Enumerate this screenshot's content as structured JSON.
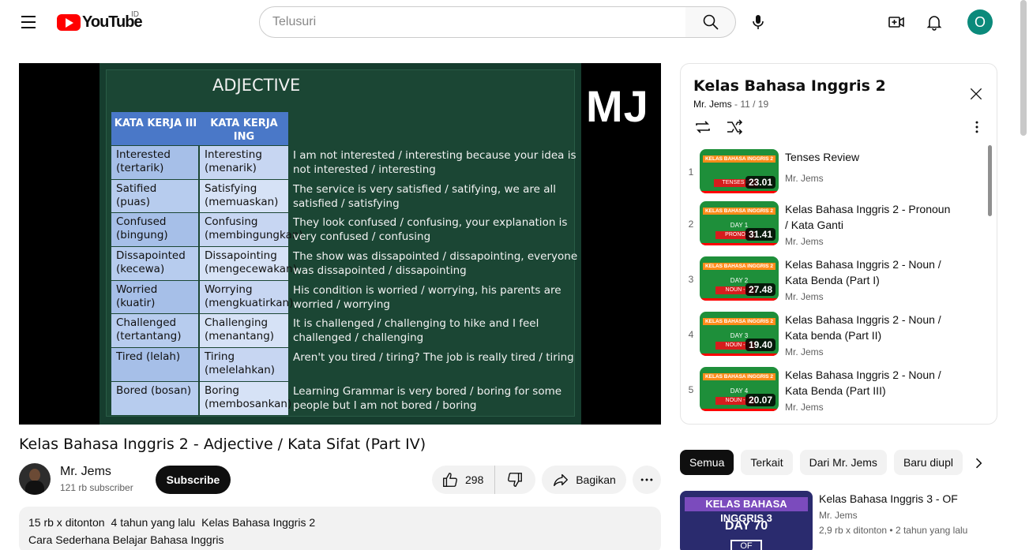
{
  "header": {
    "logo_text": "YouTube",
    "country_code": "ID",
    "search_placeholder": "Telusuri",
    "avatar_letter": "O",
    "avatar_color": "#0b8a7b"
  },
  "player": {
    "slide_title": "ADJECTIVE",
    "watermark": "MJ",
    "table_headers": [
      "KATA KERJA III",
      "KATA KERJA ING"
    ],
    "rows": [
      {
        "c1": "Interested (tertarik)",
        "c2": "Interesting (menarik)",
        "sentence": "I am not interested / interesting because your idea is not interested / interesting"
      },
      {
        "c1": "Satified (puas)",
        "c2": "Satisfying (memuaskan)",
        "sentence": "The service is very satisfied / satifying, we are all satisfied / satisfying"
      },
      {
        "c1": "Confused (bingung)",
        "c2": "Confusing (membingungkan)",
        "sentence": "They look confused / confusing, your explanation is very confused / confusing"
      },
      {
        "c1": "Dissapointed (kecewa)",
        "c2": "Dissapointing (mengecewakan)",
        "sentence": "The show was dissapointed / dissapointing, everyone was dissapointed / dissapointing"
      },
      {
        "c1": "Worried (kuatir)",
        "c2": "Worrying (mengkuatirkan)",
        "sentence": "His condition is worried / worrying, his parents are worried / worrying"
      },
      {
        "c1": "Challenged (tertantang)",
        "c2": "Challenging (menantang)",
        "sentence": "It is challenged / challenging to hike and I feel challenged / challenging"
      },
      {
        "c1": "Tired (lelah)",
        "c2": "Tiring (melelahkan)",
        "sentence": "Aren't you tired / tiring? The job is really tired / tiring"
      },
      {
        "c1": "Bored (bosan)",
        "c2": "Boring (membosankan)",
        "sentence": "Learning Grammar is very bored / boring for some people but I am not bored / boring"
      }
    ]
  },
  "video": {
    "title": "Kelas Bahasa Inggris 2 - Adjective / Kata Sifat (Part IV)",
    "channel_name": "Mr. Jems",
    "subscribers": "121 rb subscriber",
    "subscribe_label": "Subscribe",
    "likes": "298",
    "share_label": "Bagikan",
    "views": "15 rb x ditonton",
    "age": "4 tahun yang lalu",
    "playlist_tag": "Kelas Bahasa Inggris 2",
    "description": "Cara Sederhana Belajar Bahasa Inggris"
  },
  "playlist": {
    "title": "Kelas Bahasa Inggris 2",
    "owner": "Mr. Jems",
    "position": "11 / 19",
    "items": [
      {
        "index": "1",
        "title": "Tenses Review",
        "channel": "Mr. Jems",
        "duration": "23.01",
        "band": "KELAS BAHASA INGGRIS 2",
        "day": "",
        "tag": "TENSES R"
      },
      {
        "index": "2",
        "title": "Kelas Bahasa Inggris 2 - Pronoun / Kata Ganti",
        "channel": "Mr. Jems",
        "duration": "31.41",
        "band": "KELAS BAHASA INGGRIS 2",
        "day": "DAY 1",
        "tag": "PRONO"
      },
      {
        "index": "3",
        "title": "Kelas Bahasa Inggris 2 - Noun / Kata Benda (Part I)",
        "channel": "Mr. Jems",
        "duration": "27.48",
        "band": "KELAS BAHASA INGGRIS 2",
        "day": "DAY 2",
        "tag": "NOUN -"
      },
      {
        "index": "4",
        "title": "Kelas Bahasa Inggris 2 - Noun / Kata benda (Part II)",
        "channel": "Mr. Jems",
        "duration": "19.40",
        "band": "KELAS BAHASA INGGRIS 2",
        "day": "DAY 3",
        "tag": "NOUN -"
      },
      {
        "index": "5",
        "title": "Kelas Bahasa Inggris 2 - Noun / Kata Benda (Part III)",
        "channel": "Mr. Jems",
        "duration": "20.07",
        "band": "KELAS BAHASA INGGRIS 2",
        "day": "DAY 4",
        "tag": "NOUN -"
      }
    ]
  },
  "chips": [
    "Semua",
    "Terkait",
    "Dari Mr. Jems",
    "Baru diupl"
  ],
  "recommended": {
    "title": "Kelas Bahasa Inggris 3 - OF",
    "channel": "Mr. Jems",
    "views": "2,9 rb x ditonton",
    "age": "2 tahun yang lalu",
    "thumb_band": "KELAS BAHASA INGGRIS 3",
    "thumb_day": "DAY 70",
    "thumb_tag": "OF"
  }
}
